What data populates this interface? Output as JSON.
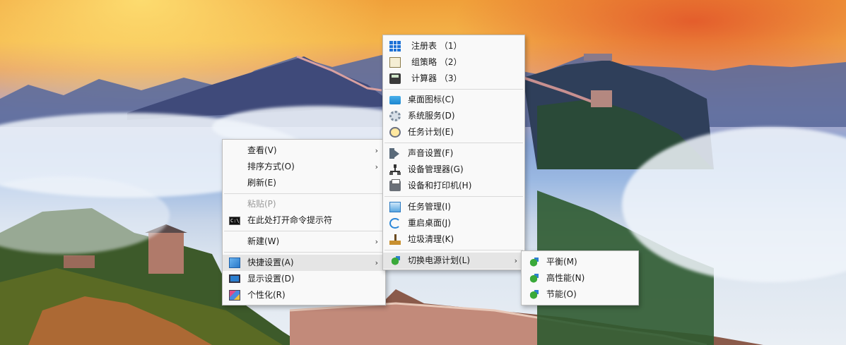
{
  "desktop_menu": {
    "items": [
      {
        "label": "查看(V)",
        "icon": "",
        "submenu": true
      },
      {
        "label": "排序方式(O)",
        "icon": "",
        "submenu": true
      },
      {
        "label": "刷新(E)",
        "icon": ""
      },
      {
        "label": "粘贴(P)",
        "icon": "",
        "disabled": true
      },
      {
        "label": "在此处打开命令提示符",
        "icon": "cmd-icon"
      },
      {
        "label": "新建(W)",
        "icon": "",
        "submenu": true
      },
      {
        "label": "快捷设置(A)",
        "icon": "quick-settings-icon",
        "submenu": true,
        "highlighted": true
      },
      {
        "label": "显示设置(D)",
        "icon": "monitor-icon"
      },
      {
        "label": "个性化(R)",
        "icon": "personalize-icon"
      }
    ]
  },
  "quick_settings_menu": {
    "items": [
      {
        "label": "注册表 （1）",
        "icon": "registry-icon"
      },
      {
        "label": "组策略 （2）",
        "icon": "group-policy-icon"
      },
      {
        "label": "计算器 （3）",
        "icon": "calculator-icon"
      },
      {
        "label": "桌面图标(C)",
        "icon": "desktop-icon"
      },
      {
        "label": "系统服务(D)",
        "icon": "services-gear-icon"
      },
      {
        "label": "任务计划(E)",
        "icon": "clock-icon"
      },
      {
        "label": "声音设置(F)",
        "icon": "speaker-icon"
      },
      {
        "label": "设备管理器(G)",
        "icon": "device-tree-icon"
      },
      {
        "label": "设备和打印机(H)",
        "icon": "printer-icon"
      },
      {
        "label": "任务管理(I)",
        "icon": "task-manager-icon"
      },
      {
        "label": "重启桌面(J)",
        "icon": "refresh-icon"
      },
      {
        "label": "垃圾清理(K)",
        "icon": "broom-icon"
      },
      {
        "label": "切换电源计划(L)",
        "icon": "power-plan-icon",
        "submenu": true,
        "highlighted": true
      }
    ]
  },
  "power_plan_menu": {
    "items": [
      {
        "label": "平衡(M)",
        "icon": "power-plan-icon"
      },
      {
        "label": "高性能(N)",
        "icon": "power-plan-icon"
      },
      {
        "label": "节能(O)",
        "icon": "power-plan-icon"
      }
    ]
  },
  "submenu_arrow": "›"
}
